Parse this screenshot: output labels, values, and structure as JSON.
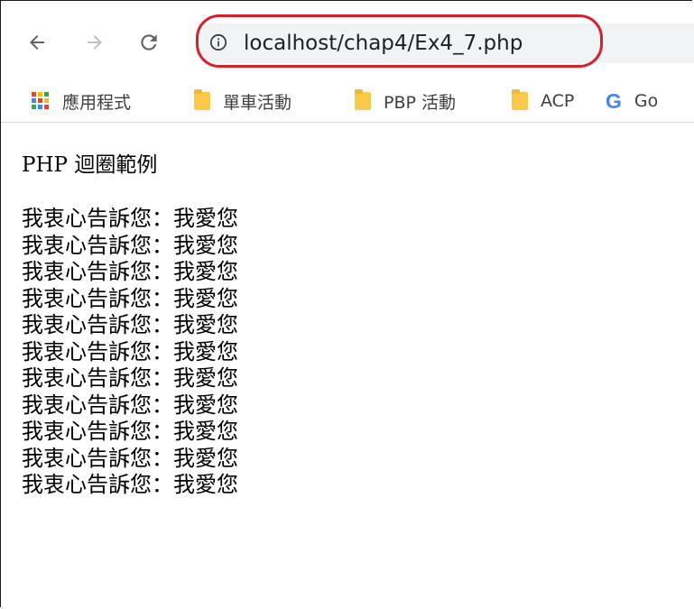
{
  "browser": {
    "url": "localhost/chap4/Ex4_7.php",
    "nav": {
      "back_icon": "arrow-left-icon",
      "forward_icon": "arrow-right-icon",
      "reload_icon": "reload-icon",
      "site_info_icon": "info-circle-icon"
    },
    "highlight_color": "#d8202a"
  },
  "bookmarks": [
    {
      "label": "應用程式",
      "icon": "apps-grid-icon"
    },
    {
      "label": "單車活動",
      "icon": "folder-icon"
    },
    {
      "label": "PBP 活動",
      "icon": "folder-icon"
    },
    {
      "label": "ACP",
      "icon": "folder-icon"
    },
    {
      "label": "Go",
      "icon": "google-icon"
    }
  ],
  "page": {
    "heading": "PHP 迴圈範例",
    "lines": [
      "我衷心告訴您：我愛您",
      "我衷心告訴您：我愛您",
      "我衷心告訴您：我愛您",
      "我衷心告訴您：我愛您",
      "我衷心告訴您：我愛您",
      "我衷心告訴您：我愛您",
      "我衷心告訴您：我愛您",
      "我衷心告訴您：我愛您",
      "我衷心告訴您：我愛您",
      "我衷心告訴您：我愛您",
      "我衷心告訴您：我愛您"
    ]
  }
}
